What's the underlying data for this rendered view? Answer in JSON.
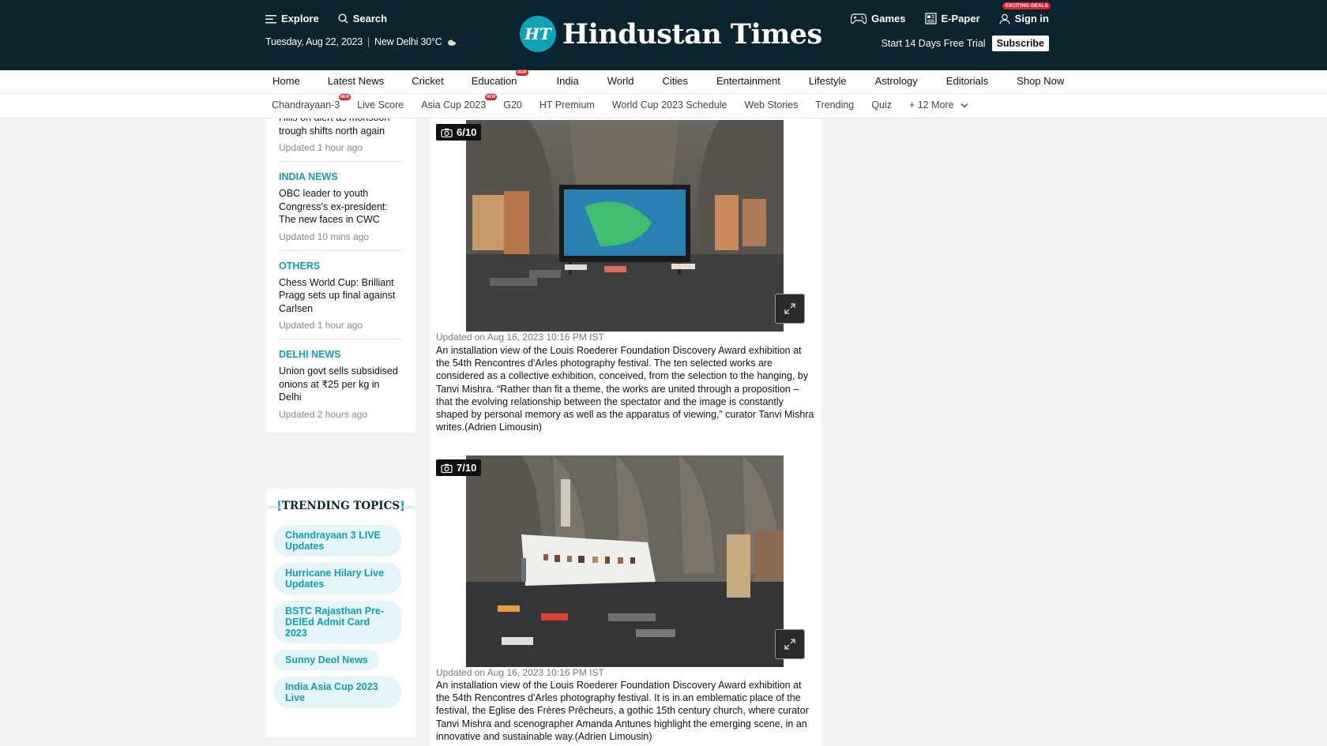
{
  "header": {
    "explore": "Explore",
    "search": "Search",
    "date": "Tuesday, Aug 22, 2023",
    "weather": "New Delhi 30°C",
    "logo_badge": "HT",
    "logo_text": "Hindustan Times",
    "games": "Games",
    "epaper": "E-Paper",
    "signin": "Sign in",
    "deals_badge": "EXCITING DEALS",
    "trial_text": "Start 14 Days Free Trial",
    "subscribe": "Subscribe"
  },
  "nav_primary": [
    {
      "label": "Home"
    },
    {
      "label": "Latest News"
    },
    {
      "label": "Cricket"
    },
    {
      "label": "Education",
      "badge": "NEW"
    },
    {
      "label": "India"
    },
    {
      "label": "World"
    },
    {
      "label": "Cities"
    },
    {
      "label": "Entertainment"
    },
    {
      "label": "Lifestyle"
    },
    {
      "label": "Astrology"
    },
    {
      "label": "Editorials"
    },
    {
      "label": "Shop Now"
    }
  ],
  "nav_secondary": [
    {
      "label": "Chandrayaan-3",
      "badge": "NEW"
    },
    {
      "label": "Live Score"
    },
    {
      "label": "Asia Cup 2023",
      "badge": "NEW"
    },
    {
      "label": "G20"
    },
    {
      "label": "HT Premium"
    },
    {
      "label": "World Cup 2023 Schedule"
    },
    {
      "label": "Web Stories"
    },
    {
      "label": "Trending"
    },
    {
      "label": "Quiz"
    },
    {
      "label": "+ 12 More"
    }
  ],
  "sidebar_news": [
    {
      "category": "",
      "title": "Hills on alert as monsoon trough shifts north again",
      "updated": "Updated 1 hour ago"
    },
    {
      "category": "INDIA NEWS",
      "title": "OBC leader to youth Congress's ex-president: The new faces in CWC",
      "updated": "Updated 10 mins ago"
    },
    {
      "category": "OTHERS",
      "title": "Chess World Cup: Brilliant Pragg sets up final against Carlsen",
      "updated": "Updated 1 hour ago"
    },
    {
      "category": "DELHI NEWS",
      "title": "Union govt sells subsidised onions at ₹25 per kg in Delhi",
      "updated": "Updated 2 hours ago"
    }
  ],
  "trending": {
    "heading": "TRENDING TOPICS",
    "bracket_left": "[",
    "bracket_right": "]",
    "topics": [
      "Chandrayaan 3 LIVE Updates",
      "Hurricane Hilary Live Updates",
      "BSTC Rajasthan Pre-DElEd Admit Card 2023",
      "Sunny Deol News",
      "India Asia Cup 2023 Live"
    ]
  },
  "gallery": [
    {
      "counter": "6/10",
      "updated": "Updated on Aug 16, 2023 10:16 PM IST",
      "caption": "An installation view of the Louis Roederer Foundation Discovery Award exhibition at the 54th Rencontres d'Arles photography festival. The ten selected works are considered as a collective exhibition, conceived, from the selection to the hanging, by Tanvi Mishra. “Rather than fit a theme, the works are united through a proposition – that the evolving relationship between the spectator and the image is constantly shaped by personal memory as well as the apparatus of viewing,” curator Tanvi Mishra writes.(Adrien Limousin)"
    },
    {
      "counter": "7/10",
      "updated": "Updated on Aug 16, 2023 10:16 PM IST",
      "caption": "An installation view of the Louis Roederer Foundation Discovery Award exhibition at the 54th Rencontres d'Arles photography festival. It is in an emblematic place of the festival, the Eglise des Frères Prêcheurs, a gothic 15th century church, where curator Tanvi Mishra and scenographer Amanda Antunes highlight the emerging scene, in an innovative and sustainable way.(Adrien Limousin)"
    }
  ]
}
